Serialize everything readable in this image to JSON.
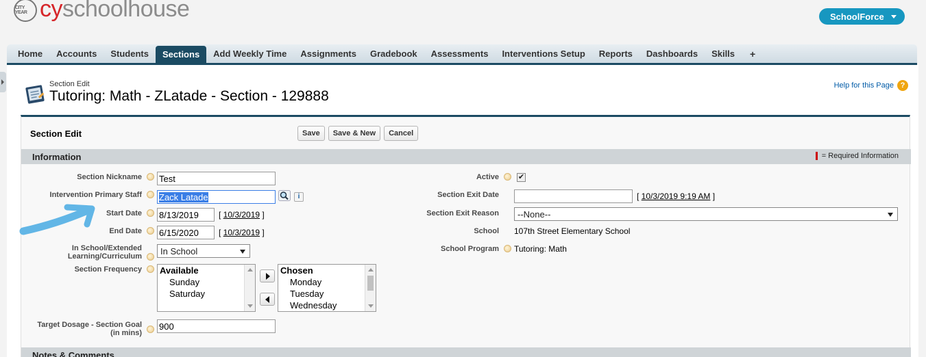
{
  "header": {
    "logo_seal": "CITY YEAR",
    "brand_prefix": "cy",
    "brand_rest": "schoolhouse",
    "app_switcher": "SchoolForce"
  },
  "tabs": [
    {
      "label": "Home"
    },
    {
      "label": "Accounts"
    },
    {
      "label": "Students"
    },
    {
      "label": "Sections",
      "active": true
    },
    {
      "label": "Add Weekly Time"
    },
    {
      "label": "Assignments"
    },
    {
      "label": "Gradebook"
    },
    {
      "label": "Assessments"
    },
    {
      "label": "Interventions Setup"
    },
    {
      "label": "Reports"
    },
    {
      "label": "Dashboards"
    },
    {
      "label": "Skills"
    },
    {
      "label": "+"
    }
  ],
  "page": {
    "subtitle": "Section Edit",
    "title": "Tutoring: Math - ZLatade - Section - 129888",
    "help_link": "Help for this Page",
    "help_icon": "?"
  },
  "block": {
    "title": "Section Edit",
    "buttons": {
      "save": "Save",
      "save_new": "Save & New",
      "cancel": "Cancel"
    },
    "info_section": "Information",
    "required_text": "= Required Information",
    "notes_section": "Notes & Comments"
  },
  "fields": {
    "nickname": {
      "label": "Section Nickname",
      "value": "Test"
    },
    "staff": {
      "label": "Intervention Primary Staff",
      "value": "Zack Latade",
      "info_icon": "i"
    },
    "start": {
      "label": "Start Date",
      "value": "8/13/2019",
      "today": "10/3/2019"
    },
    "end": {
      "label": "End Date",
      "value": "6/15/2020",
      "today": "10/3/2019"
    },
    "location": {
      "label": "In School/Extended Learning/Curriculum",
      "value": "In School"
    },
    "frequency": {
      "label": "Section Frequency",
      "available_header": "Available",
      "available": [
        "Sunday",
        "Saturday"
      ],
      "chosen_header": "Chosen",
      "chosen": [
        "Monday",
        "Tuesday",
        "Wednesday"
      ]
    },
    "dosage": {
      "label": "Target Dosage - Section Goal (in mins)",
      "value": "900"
    },
    "active": {
      "label": "Active",
      "checked": true,
      "check_glyph": "✔"
    },
    "exit_date": {
      "label": "Section Exit Date",
      "value": "",
      "now": "10/3/2019 9:19 AM"
    },
    "exit_reason": {
      "label": "Section Exit Reason",
      "value": "--None--"
    },
    "school": {
      "label": "School",
      "value": "107th Street Elementary School"
    },
    "program": {
      "label": "School Program",
      "value": "Tutoring: Math"
    }
  },
  "colors": {
    "brand_red": "#d6262a",
    "tab_active": "#1b4b63",
    "app_switcher": "#1797c0",
    "annotation_arrow": "#62b6e6"
  }
}
